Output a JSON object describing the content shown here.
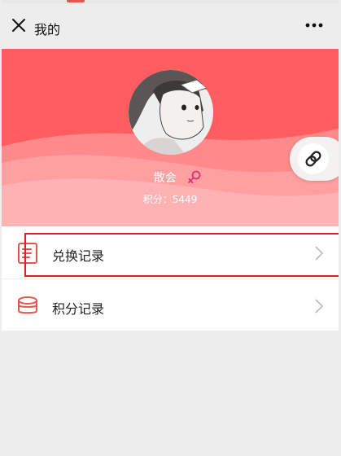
{
  "nav": {
    "title": "我的",
    "close_icon": "close-icon",
    "more_icon": "more-dots-icon"
  },
  "profile": {
    "name": "散会",
    "gender_icon": "female-icon",
    "points_label": "积分：5449",
    "points": 5449,
    "avatar_icon": "avatar-illustration"
  },
  "fab": {
    "icon": "link-icon"
  },
  "menu": [
    {
      "label": "兑换记录",
      "icon": "list-document-icon",
      "highlighted": true
    },
    {
      "label": "积分记录",
      "icon": "coins-stack-icon",
      "highlighted": false
    }
  ],
  "colors": {
    "hero": "#ff5d5f",
    "accent_icon": "#e2574c",
    "gender": "#e0307a",
    "highlight_border": "#e11d1d"
  }
}
